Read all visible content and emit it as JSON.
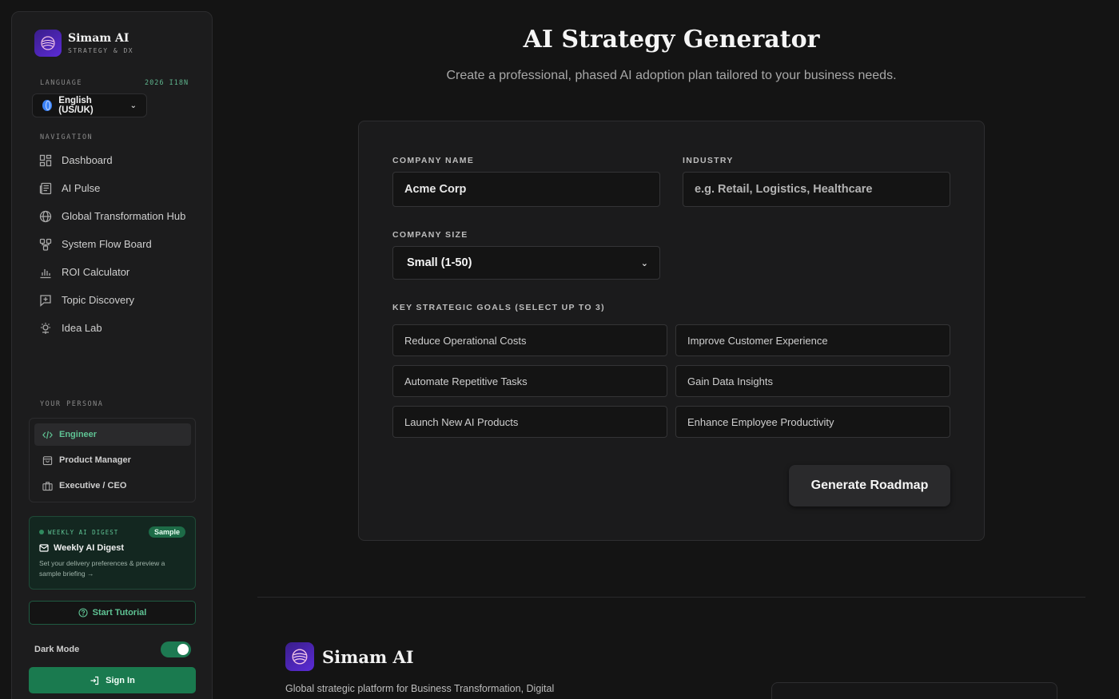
{
  "brand": {
    "name": "Simam AI",
    "tagline": "STRATEGY & DX"
  },
  "sidebar": {
    "language_label": "LANGUAGE",
    "i18n_badge": "2026 I18N",
    "language_value": "English (US/UK)",
    "navigation_label": "NAVIGATION",
    "nav_items": [
      {
        "label": "Dashboard",
        "icon": "dashboard-icon"
      },
      {
        "label": "AI Pulse",
        "icon": "newspaper-icon"
      },
      {
        "label": "Global Transformation Hub",
        "icon": "globe-icon"
      },
      {
        "label": "System Flow Board",
        "icon": "flow-icon"
      },
      {
        "label": "ROI Calculator",
        "icon": "bar-chart-icon"
      },
      {
        "label": "Topic Discovery",
        "icon": "message-plus-icon"
      },
      {
        "label": "Idea Lab",
        "icon": "brain-icon"
      }
    ],
    "persona_label": "YOUR PERSONA",
    "personas": [
      {
        "label": "Engineer",
        "icon": "code-icon",
        "active": true
      },
      {
        "label": "Product Manager",
        "icon": "shopping-bag-icon",
        "active": false
      },
      {
        "label": "Executive / CEO",
        "icon": "briefcase-icon",
        "active": false
      }
    ],
    "digest": {
      "tag": "WEEKLY AI DIGEST",
      "badge": "Sample",
      "title": "Weekly AI Digest",
      "description": "Set your delivery preferences & preview a sample briefing →"
    },
    "tutorial_label": "Start Tutorial",
    "dark_mode_label": "Dark Mode",
    "dark_mode_on": true,
    "sign_in_label": "Sign In"
  },
  "main": {
    "title": "AI Strategy Generator",
    "subtitle": "Create a professional, phased AI adoption plan tailored to your business needs.",
    "form": {
      "company_name_label": "COMPANY NAME",
      "company_name_value": "Acme Corp",
      "industry_label": "INDUSTRY",
      "industry_placeholder": "e.g. Retail, Logistics, Healthcare",
      "company_size_label": "COMPANY SIZE",
      "company_size_value": "Small (1-50)",
      "goals_label": "KEY STRATEGIC GOALS (SELECT UP TO 3)",
      "goals": [
        "Reduce Operational Costs",
        "Improve Customer Experience",
        "Automate Repetitive Tasks",
        "Gain Data Insights",
        "Launch New AI Products",
        "Enhance Employee Productivity"
      ],
      "generate_label": "Generate Roadmap"
    }
  },
  "footer": {
    "brand_name": "Simam AI",
    "description": "Global strategic platform for Business Transformation, Digital"
  },
  "colors": {
    "accent_green": "#5fc394",
    "button_green": "#1a7a4f",
    "logo_purple": "#5b2bd6",
    "background": "#141414"
  }
}
